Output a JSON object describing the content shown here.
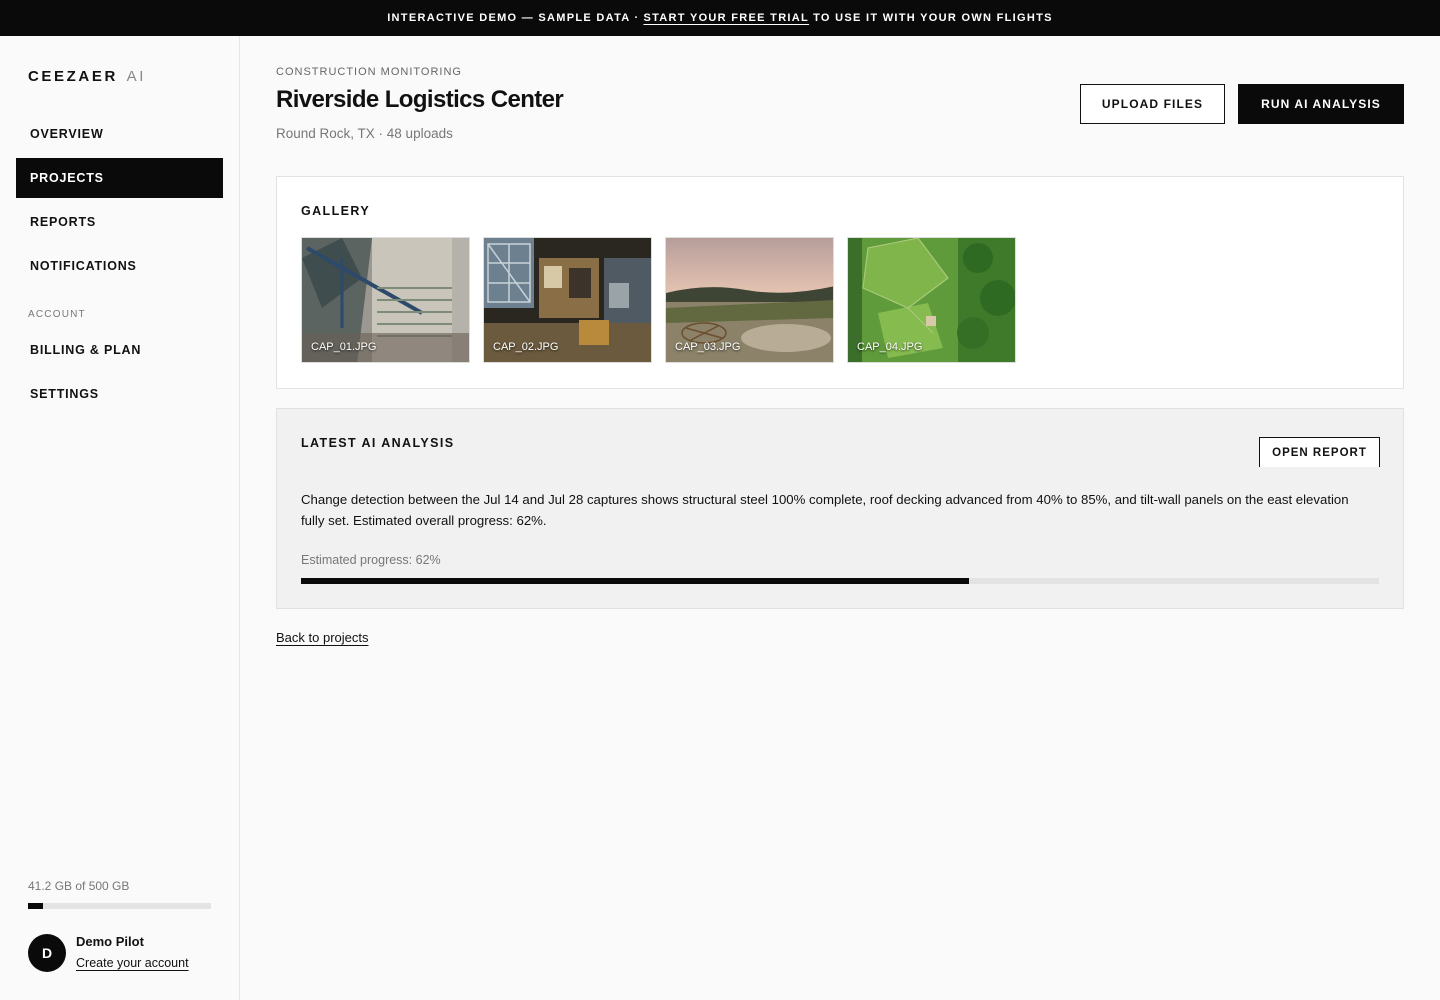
{
  "banner": {
    "prefix": "INTERACTIVE DEMO — SAMPLE DATA ·",
    "link": "START YOUR FREE TRIAL",
    "suffix": "TO USE IT WITH YOUR OWN FLIGHTS"
  },
  "sidebar": {
    "brand": "CEEZAER",
    "brand_suffix": "AI",
    "items": [
      {
        "label": "OVERVIEW",
        "active": false
      },
      {
        "label": "PROJECTS",
        "active": true
      },
      {
        "label": "REPORTS",
        "active": false
      },
      {
        "label": "NOTIFICATIONS",
        "active": false
      }
    ],
    "section_label": "ACCOUNT",
    "account_items": [
      {
        "label": "BILLING & PLAN"
      },
      {
        "label": "SETTINGS"
      }
    ],
    "storage": {
      "text": "41.2 GB of 500 GB",
      "used_fraction": 0.0824
    },
    "user": {
      "initial": "D",
      "name": "Demo Pilot",
      "link": "Create your account"
    }
  },
  "header": {
    "eyebrow": "CONSTRUCTION MONITORING",
    "title": "Riverside Logistics Center",
    "subtitle": "Round Rock, TX · 48 uploads",
    "upload_label": "UPLOAD FILES",
    "run_label": "RUN AI ANALYSIS"
  },
  "gallery": {
    "title": "GALLERY",
    "images": [
      {
        "label": "CAP_01.JPG"
      },
      {
        "label": "CAP_02.JPG"
      },
      {
        "label": "CAP_03.JPG"
      },
      {
        "label": "CAP_04.JPG"
      }
    ]
  },
  "analysis": {
    "title": "LATEST AI ANALYSIS",
    "open_label": "OPEN REPORT",
    "text": "Change detection between the Jul 14 and Jul 28 captures shows structural steel 100% complete, roof decking advanced from 40% to 85%, and tilt-wall panels on the east elevation fully set. Estimated overall progress: 62%.",
    "progress_label": "Estimated progress: 62%",
    "progress": 0.62
  },
  "footer": {
    "back_link": "Back to projects"
  },
  "colors": {
    "accent": "#0a0a0a",
    "background": "#fafafa",
    "muted": "#777777"
  }
}
